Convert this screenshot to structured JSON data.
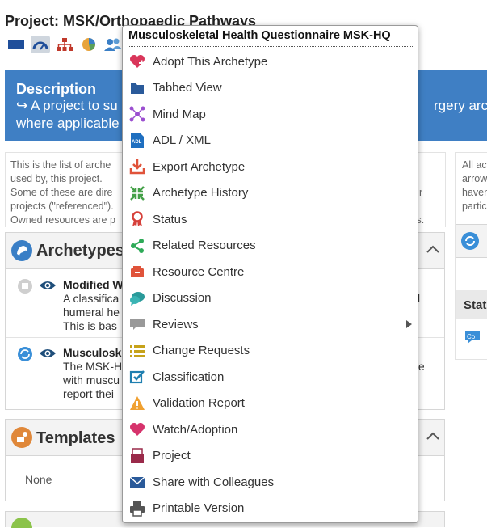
{
  "header": {
    "title": "Project: MSK/Orthopaedic Pathways"
  },
  "toolbar": {
    "icons": [
      "table-icon",
      "gauge-icon",
      "org-chart-icon",
      "pie-chart-icon",
      "users-icon"
    ]
  },
  "description": {
    "heading": "Description",
    "line1": "↪ A project to su",
    "line2": "where applicable",
    "right_fragment": "rgery arche"
  },
  "info": {
    "lines": [
      "This is the list of arche",
      "used by, this project.",
      "Some of these are dire",
      "projects (\"referenced\").",
      "Owned resources are p"
    ],
    "right_lines": [
      "r",
      "ts."
    ]
  },
  "right_column": {
    "lines": [
      "All ac",
      "arrow",
      "haven",
      "partic"
    ],
    "status_label": "Stat"
  },
  "archetypes": {
    "title": "Archetypes",
    "rows": [
      {
        "title": "Modified W",
        "lines": [
          "A classifica",
          "humeral he",
          "This is bas"
        ],
        "right": "l"
      },
      {
        "title": "Musculosk",
        "lines": [
          "The MSK-H",
          "with muscu",
          "report thei"
        ],
        "right": "ble"
      }
    ]
  },
  "templates": {
    "title": "Templates",
    "empty_text": "None"
  },
  "menu": {
    "title": "Musculoskeletal Health Questionnaire MSK-HQ",
    "items": [
      {
        "label": "Adopt This Archetype",
        "icon": "heart-plus-icon",
        "color": "#d9365a"
      },
      {
        "label": "Tabbed View",
        "icon": "folder-icon",
        "color": "#2a5a9a"
      },
      {
        "label": "Mind Map",
        "icon": "mind-map-icon",
        "color": "#9b4fd0"
      },
      {
        "label": "ADL / XML",
        "icon": "adl-icon",
        "color": "#1f6fc0"
      },
      {
        "label": "Export Archetype",
        "icon": "download-icon",
        "color": "#e0533a"
      },
      {
        "label": "Archetype History",
        "icon": "history-icon",
        "color": "#43a047"
      },
      {
        "label": "Status",
        "icon": "ribbon-icon",
        "color": "#d6403a"
      },
      {
        "label": "Related Resources",
        "icon": "share-icon",
        "color": "#2eaa58"
      },
      {
        "label": "Resource Centre",
        "icon": "resource-centre-icon",
        "color": "#e0533a"
      },
      {
        "label": "Discussion",
        "icon": "chat-icon",
        "color": "#2a9a9a"
      },
      {
        "label": "Reviews",
        "icon": "comment-icon",
        "color": "#999999",
        "submenu": true
      },
      {
        "label": "Change Requests",
        "icon": "list-icon",
        "color": "#c6a21a"
      },
      {
        "label": "Classification",
        "icon": "checkbox-icon",
        "color": "#1f7fb0"
      },
      {
        "label": "Validation Report",
        "icon": "warning-icon",
        "color": "#f0a030"
      },
      {
        "label": "Watch/Adoption",
        "icon": "heart-icon",
        "color": "#d6336c"
      },
      {
        "label": "Project",
        "icon": "project-icon",
        "color": "#9a2a4a"
      },
      {
        "label": "Share with Colleagues",
        "icon": "envelope-icon",
        "color": "#2a5a9a"
      },
      {
        "label": "Printable Version",
        "icon": "printer-icon",
        "color": "#555555"
      }
    ]
  }
}
